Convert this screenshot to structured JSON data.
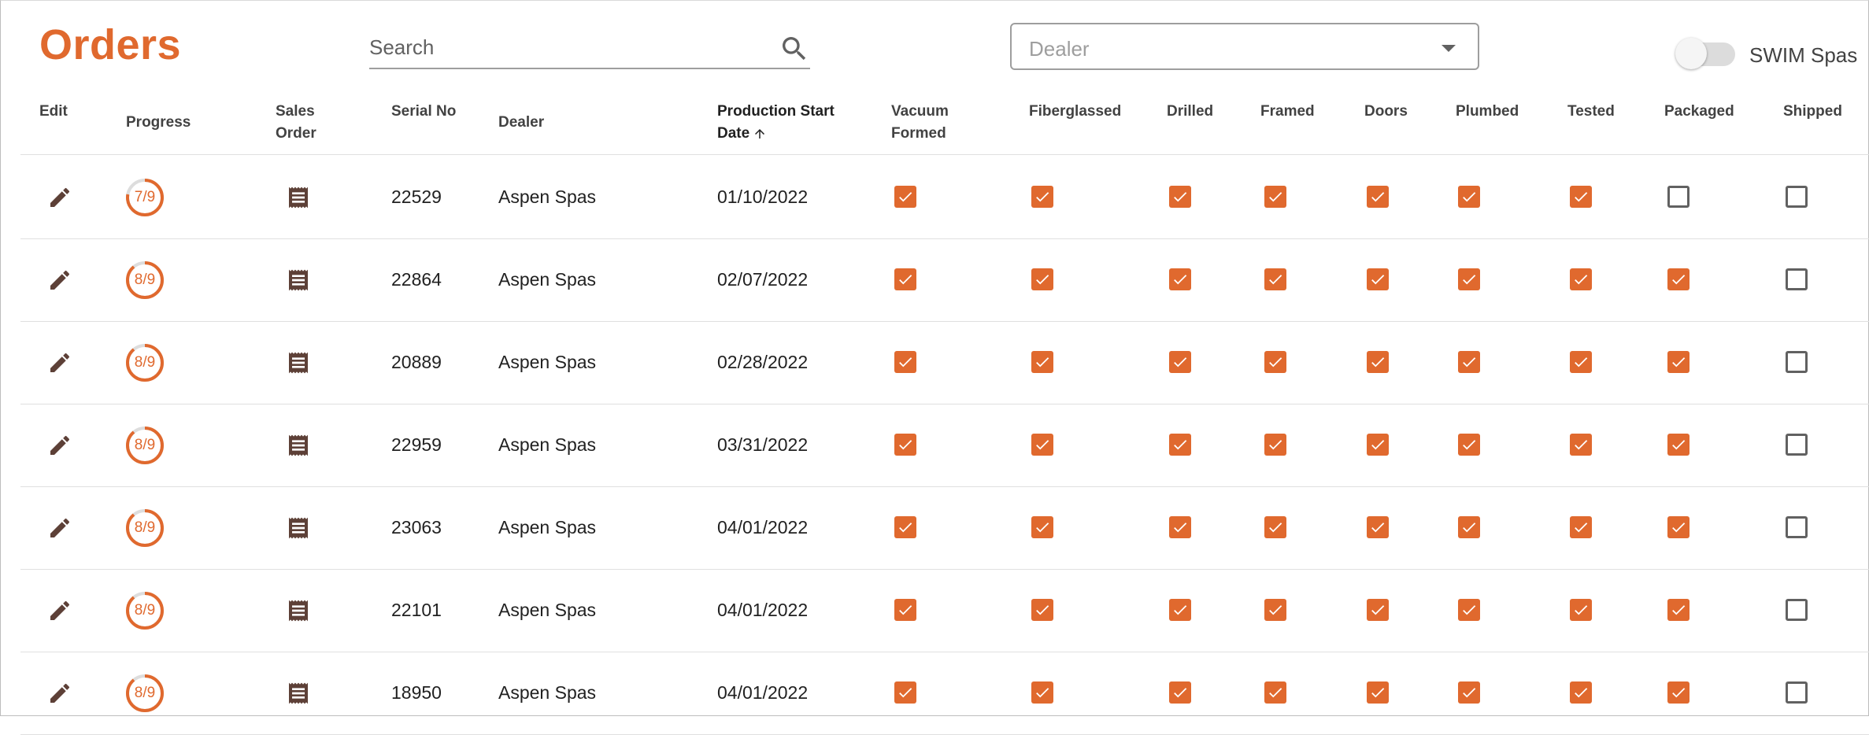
{
  "page": {
    "title": "Orders"
  },
  "search": {
    "placeholder": "Search"
  },
  "dealer_select": {
    "placeholder": "Dealer"
  },
  "swim_toggle": {
    "label": "SWIM Spas",
    "on": false
  },
  "colors": {
    "accent": "#e0692e",
    "icon_dark": "#5d4037",
    "unchecked_border": "#616161"
  },
  "columns": [
    {
      "key": "edit",
      "label": "Edit"
    },
    {
      "key": "progress",
      "label": "Progress"
    },
    {
      "key": "sales_order",
      "label": "Sales Order"
    },
    {
      "key": "serial",
      "label": "Serial No"
    },
    {
      "key": "dealer",
      "label": "Dealer"
    },
    {
      "key": "start_date",
      "label": "Production Start Date",
      "sorted": "asc"
    },
    {
      "key": "vacuum_formed",
      "label": "Vacuum Formed"
    },
    {
      "key": "fiberglassed",
      "label": "Fiberglassed"
    },
    {
      "key": "drilled",
      "label": "Drilled"
    },
    {
      "key": "framed",
      "label": "Framed"
    },
    {
      "key": "doors",
      "label": "Doors"
    },
    {
      "key": "plumbed",
      "label": "Plumbed"
    },
    {
      "key": "tested",
      "label": "Tested"
    },
    {
      "key": "packaged",
      "label": "Packaged"
    },
    {
      "key": "shipped",
      "label": "Shipped"
    }
  ],
  "icons": {
    "edit": "pencil-icon",
    "sales_order": "receipt-icon",
    "search": "search-icon",
    "dropdown": "caret-down-icon",
    "sort": "arrow-up-icon"
  },
  "rows": [
    {
      "progress": "7/9",
      "done": 7,
      "total": 9,
      "serial": "22529",
      "dealer": "Aspen Spas",
      "date": "01/10/2022",
      "checks": [
        true,
        true,
        true,
        true,
        true,
        true,
        true,
        false,
        false
      ]
    },
    {
      "progress": "8/9",
      "done": 8,
      "total": 9,
      "serial": "22864",
      "dealer": "Aspen Spas",
      "date": "02/07/2022",
      "checks": [
        true,
        true,
        true,
        true,
        true,
        true,
        true,
        true,
        false
      ]
    },
    {
      "progress": "8/9",
      "done": 8,
      "total": 9,
      "serial": "20889",
      "dealer": "Aspen Spas",
      "date": "02/28/2022",
      "checks": [
        true,
        true,
        true,
        true,
        true,
        true,
        true,
        true,
        false
      ]
    },
    {
      "progress": "8/9",
      "done": 8,
      "total": 9,
      "serial": "22959",
      "dealer": "Aspen Spas",
      "date": "03/31/2022",
      "checks": [
        true,
        true,
        true,
        true,
        true,
        true,
        true,
        true,
        false
      ]
    },
    {
      "progress": "8/9",
      "done": 8,
      "total": 9,
      "serial": "23063",
      "dealer": "Aspen Spas",
      "date": "04/01/2022",
      "checks": [
        true,
        true,
        true,
        true,
        true,
        true,
        true,
        true,
        false
      ]
    },
    {
      "progress": "8/9",
      "done": 8,
      "total": 9,
      "serial": "22101",
      "dealer": "Aspen Spas",
      "date": "04/01/2022",
      "checks": [
        true,
        true,
        true,
        true,
        true,
        true,
        true,
        true,
        false
      ]
    },
    {
      "progress": "8/9",
      "done": 8,
      "total": 9,
      "serial": "18950",
      "dealer": "Aspen Spas",
      "date": "04/01/2022",
      "checks": [
        true,
        true,
        true,
        true,
        true,
        true,
        true,
        true,
        false
      ]
    }
  ]
}
